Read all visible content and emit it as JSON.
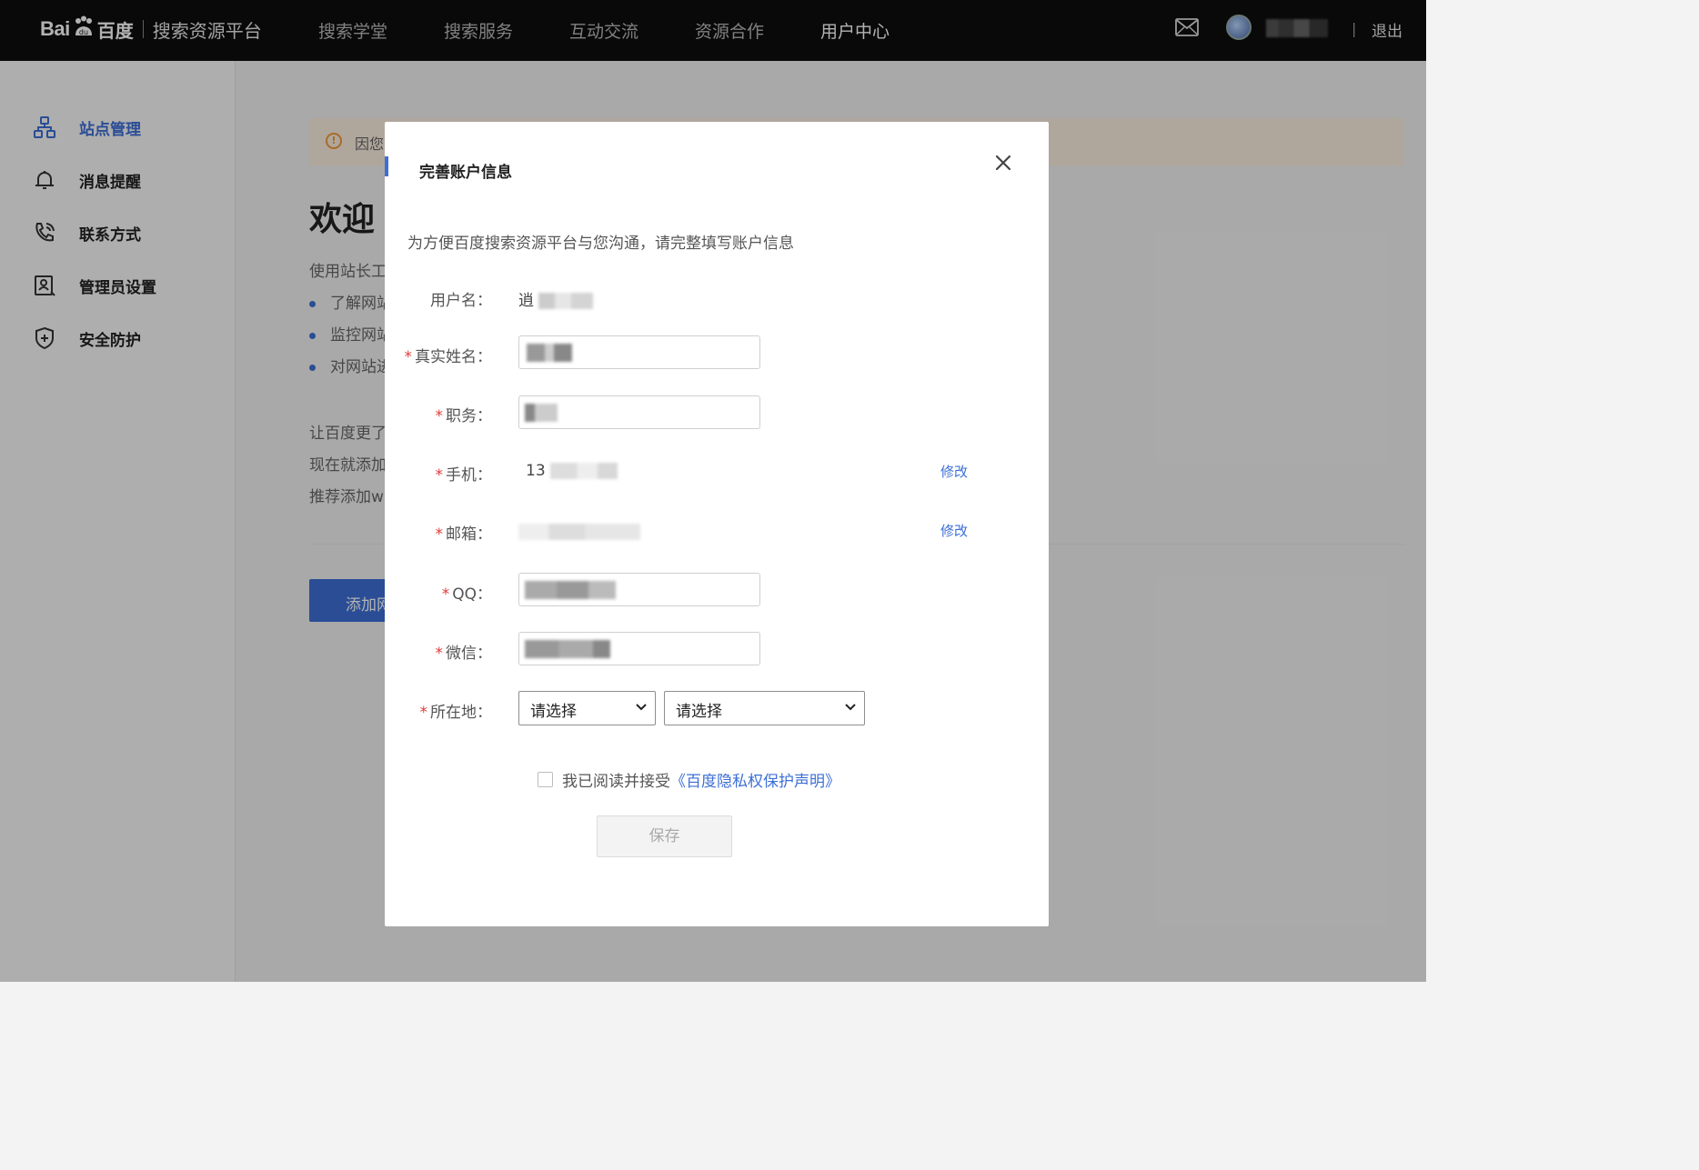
{
  "header": {
    "logo_bai": "Bai",
    "logo_baidu": "百度",
    "platform_title": "搜索资源平台",
    "nav": [
      {
        "label": "搜索学堂",
        "active": false
      },
      {
        "label": "搜索服务",
        "active": false
      },
      {
        "label": "互动交流",
        "active": false
      },
      {
        "label": "资源合作",
        "active": false
      },
      {
        "label": "用户中心",
        "active": true
      }
    ],
    "divider": "|",
    "logout": "退出"
  },
  "sidebar": {
    "items": [
      {
        "label": "站点管理",
        "icon": "sitemap-icon",
        "active": true
      },
      {
        "label": "消息提醒",
        "icon": "bell-icon",
        "active": false
      },
      {
        "label": "联系方式",
        "icon": "phone-icon",
        "active": false
      },
      {
        "label": "管理员设置",
        "icon": "admin-settings-icon",
        "active": false
      },
      {
        "label": "安全防护",
        "icon": "shield-icon",
        "active": false
      }
    ]
  },
  "main": {
    "notice_text": "因您",
    "welcome_title": "欢迎",
    "intro": "使用站长工",
    "bullets": [
      "了解网站",
      "监控网站",
      "对网站进"
    ],
    "paragraphs": [
      "让百度更了",
      "现在就添加",
      "推荐添加w"
    ],
    "add_button": "添加网"
  },
  "modal": {
    "title": "完善账户信息",
    "description": "为方便百度搜索资源平台与您沟通，请完整填写账户信息",
    "username_label": "用户名：",
    "username_value": "逍",
    "real_name_label": "真实姓名：",
    "position_label": "职务：",
    "phone_label": "手机：",
    "phone_value": "13",
    "email_label": "邮箱：",
    "qq_label": "QQ：",
    "wechat_label": "微信：",
    "location_label": "所在地：",
    "required_mark": "*",
    "edit_label": "修改",
    "select_province": "请选择",
    "select_city": "请选择",
    "agree_prefix": "我已阅读并接受",
    "agree_link": "《百度隐私权保护声明》",
    "save_button": "保存"
  },
  "colors": {
    "accent": "#3d6fd6",
    "required": "#e23a3a",
    "topbar": "#0e0e0e"
  }
}
